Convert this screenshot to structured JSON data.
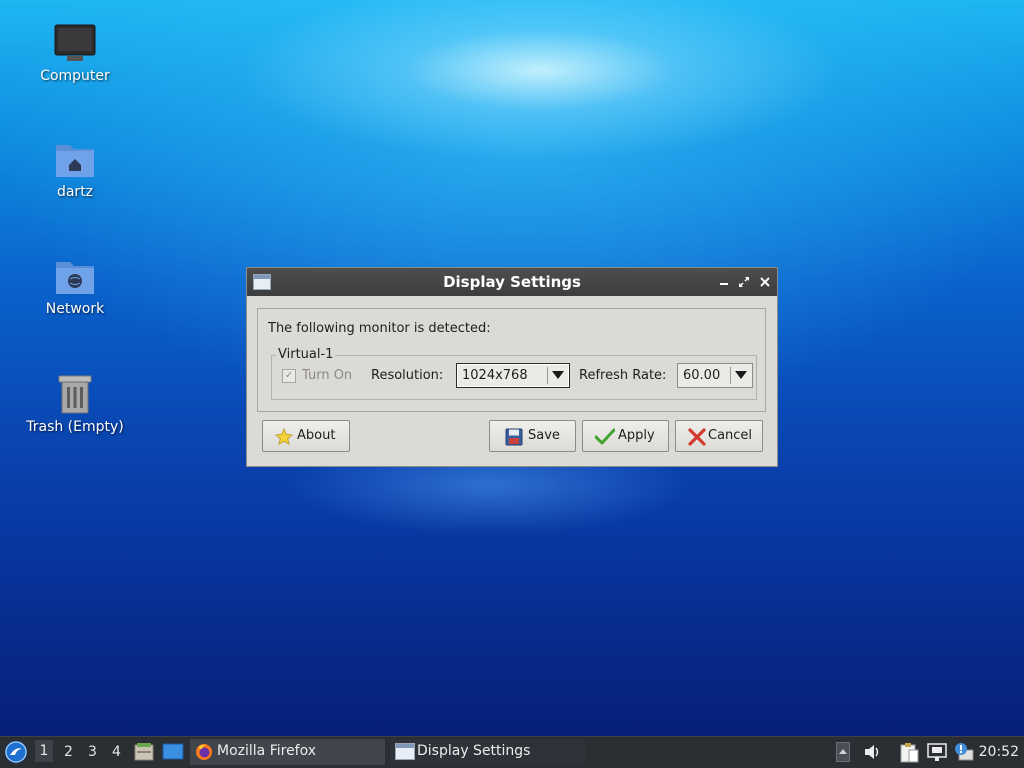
{
  "desktop": {
    "icons": [
      {
        "label": "Computer"
      },
      {
        "label": "dartz"
      },
      {
        "label": "Network"
      },
      {
        "label": "Trash (Empty)"
      }
    ]
  },
  "dialog": {
    "title": "Display Settings",
    "detected_label": "The following monitor is detected:",
    "monitor": {
      "name": "Virtual-1",
      "turn_on_label": "Turn On",
      "turn_on_checked": true,
      "resolution_label": "Resolution:",
      "resolution_value": "1024x768",
      "refresh_label": "Refresh Rate:",
      "refresh_value": "60.00"
    },
    "buttons": {
      "about": "About",
      "save": "Save",
      "apply": "Apply",
      "cancel": "Cancel"
    }
  },
  "taskbar": {
    "workspaces": [
      "1",
      "2",
      "3",
      "4"
    ],
    "active_workspace": "1",
    "tasks": [
      {
        "label": "Mozilla Firefox"
      },
      {
        "label": "Display Settings"
      }
    ],
    "clock": "20:52"
  },
  "colors": {
    "titlebar": "#3f4042",
    "dialog_bg": "#dcdad5",
    "taskbar": "#2b2e33",
    "desktop_top": "#1fb6f3",
    "desktop_bottom": "#061f78"
  }
}
